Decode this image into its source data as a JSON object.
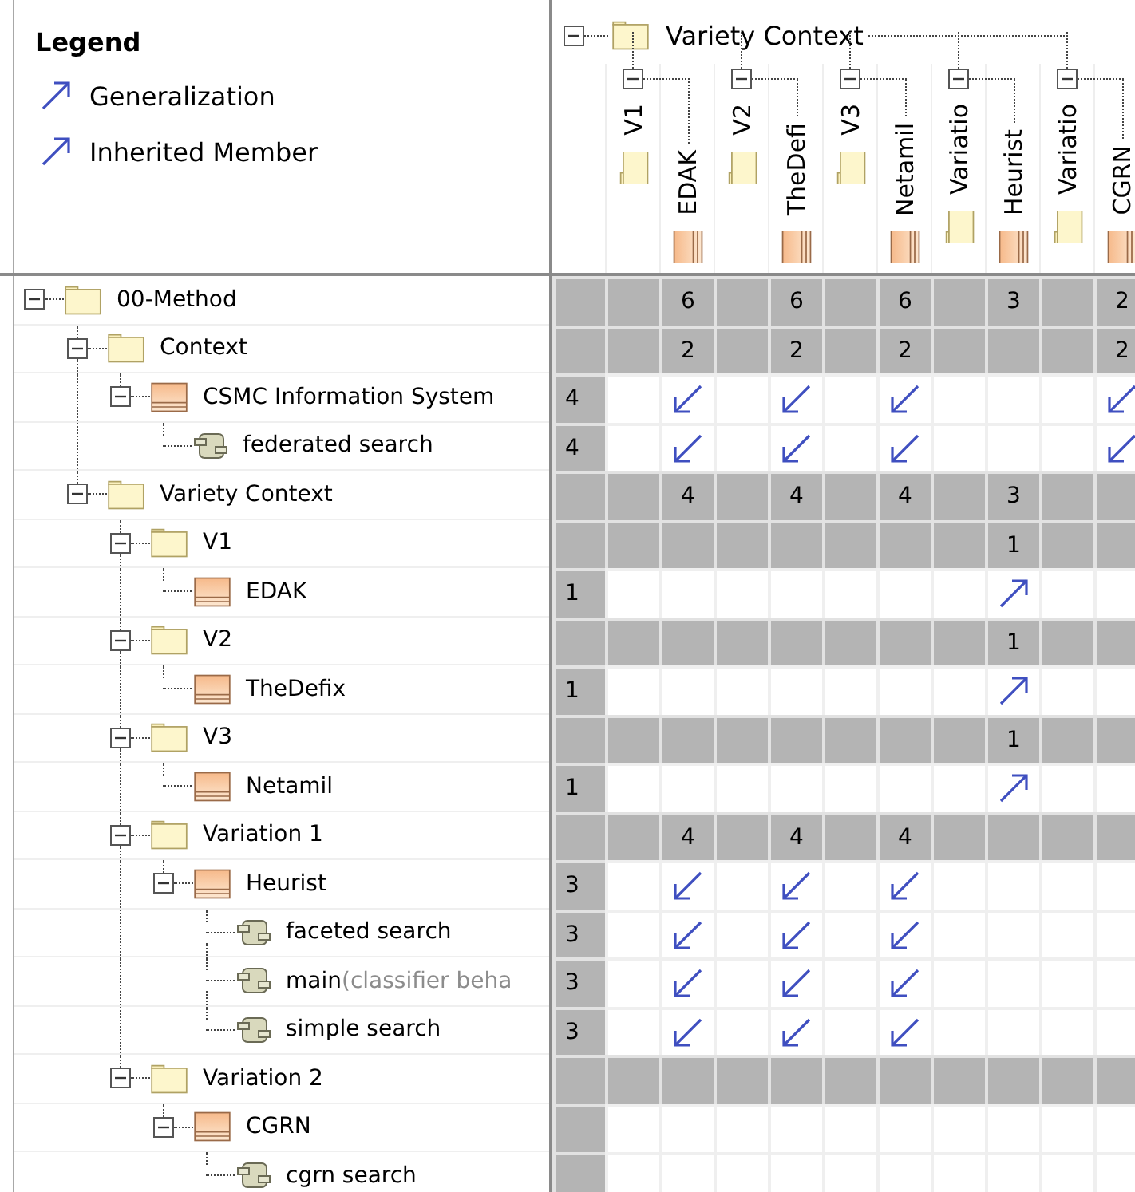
{
  "legend": {
    "title": "Legend",
    "items": [
      {
        "label": "Generalization"
      },
      {
        "label": "Inherited Member"
      }
    ]
  },
  "column_tree": {
    "name": "Variety Context",
    "kind": "package",
    "expanded": true,
    "children": [
      {
        "name": "V1",
        "kind": "package",
        "expanded": true,
        "children": [
          {
            "name": "EDAK",
            "kind": "class"
          }
        ]
      },
      {
        "name": "V2",
        "kind": "package",
        "expanded": true,
        "children": [
          {
            "name": "TheDefi",
            "kind": "class"
          }
        ]
      },
      {
        "name": "V3",
        "kind": "package",
        "expanded": true,
        "children": [
          {
            "name": "Netamil",
            "kind": "class"
          }
        ]
      },
      {
        "name": "Variatio",
        "kind": "package",
        "expanded": true,
        "children": [
          {
            "name": "Heurist",
            "kind": "class"
          }
        ]
      },
      {
        "name": "Variatio",
        "kind": "package",
        "expanded": true,
        "children": [
          {
            "name": "CGRN",
            "kind": "class"
          }
        ]
      }
    ]
  },
  "row_tree": [
    {
      "name": "00-Method",
      "kind": "package",
      "expanded": true,
      "cells": [
        {
          "kind": "empty"
        },
        {
          "kind": "count",
          "text": "6"
        },
        {
          "kind": "empty"
        },
        {
          "kind": "count",
          "text": "6"
        },
        {
          "kind": "empty"
        },
        {
          "kind": "count",
          "text": "6"
        },
        {
          "kind": "empty"
        },
        {
          "kind": "count",
          "text": "3"
        },
        {
          "kind": "empty"
        },
        {
          "kind": "count",
          "text": "2"
        }
      ],
      "children": [
        {
          "name": "Context",
          "kind": "package",
          "expanded": true,
          "cells": [
            {
              "kind": "empty"
            },
            {
              "kind": "count",
              "text": "2"
            },
            {
              "kind": "empty"
            },
            {
              "kind": "count",
              "text": "2"
            },
            {
              "kind": "empty"
            },
            {
              "kind": "count",
              "text": "2"
            },
            {
              "kind": "empty"
            },
            {
              "kind": "empty"
            },
            {
              "kind": "empty"
            },
            {
              "kind": "count",
              "text": "2"
            }
          ],
          "children": [
            {
              "name": "CSMC Information System",
              "kind": "class",
              "expanded": true,
              "total": "4",
              "cells": [
                {
                  "kind": "empty"
                },
                {
                  "kind": "down-left"
                },
                {
                  "kind": "empty"
                },
                {
                  "kind": "down-left"
                },
                {
                  "kind": "empty"
                },
                {
                  "kind": "down-left"
                },
                {
                  "kind": "empty"
                },
                {
                  "kind": "empty"
                },
                {
                  "kind": "empty"
                },
                {
                  "kind": "down-left"
                }
              ],
              "children": [
                {
                  "name": "federated search",
                  "kind": "part",
                  "total": "4",
                  "cells": [
                    {
                      "kind": "empty"
                    },
                    {
                      "kind": "down-left"
                    },
                    {
                      "kind": "empty"
                    },
                    {
                      "kind": "down-left"
                    },
                    {
                      "kind": "empty"
                    },
                    {
                      "kind": "down-left"
                    },
                    {
                      "kind": "empty"
                    },
                    {
                      "kind": "empty"
                    },
                    {
                      "kind": "empty"
                    },
                    {
                      "kind": "down-left"
                    }
                  ]
                }
              ]
            }
          ]
        },
        {
          "name": "Variety Context",
          "kind": "package",
          "expanded": true,
          "cells": [
            {
              "kind": "empty"
            },
            {
              "kind": "count",
              "text": "4"
            },
            {
              "kind": "empty"
            },
            {
              "kind": "count",
              "text": "4"
            },
            {
              "kind": "empty"
            },
            {
              "kind": "count",
              "text": "4"
            },
            {
              "kind": "empty"
            },
            {
              "kind": "count",
              "text": "3"
            },
            {
              "kind": "empty"
            },
            {
              "kind": "empty"
            }
          ],
          "children": [
            {
              "name": "V1",
              "kind": "package",
              "expanded": true,
              "cells": [
                {
                  "kind": "empty"
                },
                {
                  "kind": "empty"
                },
                {
                  "kind": "empty"
                },
                {
                  "kind": "empty"
                },
                {
                  "kind": "empty"
                },
                {
                  "kind": "empty"
                },
                {
                  "kind": "empty"
                },
                {
                  "kind": "count",
                  "text": "1"
                },
                {
                  "kind": "empty"
                },
                {
                  "kind": "empty"
                }
              ],
              "children": [
                {
                  "name": "EDAK",
                  "kind": "class",
                  "total": "1",
                  "cells": [
                    {
                      "kind": "empty"
                    },
                    {
                      "kind": "empty"
                    },
                    {
                      "kind": "empty"
                    },
                    {
                      "kind": "empty"
                    },
                    {
                      "kind": "empty"
                    },
                    {
                      "kind": "empty"
                    },
                    {
                      "kind": "empty"
                    },
                    {
                      "kind": "up-right"
                    },
                    {
                      "kind": "empty"
                    },
                    {
                      "kind": "empty"
                    }
                  ]
                }
              ]
            },
            {
              "name": "V2",
              "kind": "package",
              "expanded": true,
              "cells": [
                {
                  "kind": "empty"
                },
                {
                  "kind": "empty"
                },
                {
                  "kind": "empty"
                },
                {
                  "kind": "empty"
                },
                {
                  "kind": "empty"
                },
                {
                  "kind": "empty"
                },
                {
                  "kind": "empty"
                },
                {
                  "kind": "count",
                  "text": "1"
                },
                {
                  "kind": "empty"
                },
                {
                  "kind": "empty"
                }
              ],
              "children": [
                {
                  "name": "TheDefix",
                  "kind": "class",
                  "total": "1",
                  "cells": [
                    {
                      "kind": "empty"
                    },
                    {
                      "kind": "empty"
                    },
                    {
                      "kind": "empty"
                    },
                    {
                      "kind": "empty"
                    },
                    {
                      "kind": "empty"
                    },
                    {
                      "kind": "empty"
                    },
                    {
                      "kind": "empty"
                    },
                    {
                      "kind": "up-right"
                    },
                    {
                      "kind": "empty"
                    },
                    {
                      "kind": "empty"
                    }
                  ]
                }
              ]
            },
            {
              "name": "V3",
              "kind": "package",
              "expanded": true,
              "cells": [
                {
                  "kind": "empty"
                },
                {
                  "kind": "empty"
                },
                {
                  "kind": "empty"
                },
                {
                  "kind": "empty"
                },
                {
                  "kind": "empty"
                },
                {
                  "kind": "empty"
                },
                {
                  "kind": "empty"
                },
                {
                  "kind": "count",
                  "text": "1"
                },
                {
                  "kind": "empty"
                },
                {
                  "kind": "empty"
                }
              ],
              "children": [
                {
                  "name": "Netamil",
                  "kind": "class",
                  "total": "1",
                  "cells": [
                    {
                      "kind": "empty"
                    },
                    {
                      "kind": "empty"
                    },
                    {
                      "kind": "empty"
                    },
                    {
                      "kind": "empty"
                    },
                    {
                      "kind": "empty"
                    },
                    {
                      "kind": "empty"
                    },
                    {
                      "kind": "empty"
                    },
                    {
                      "kind": "up-right"
                    },
                    {
                      "kind": "empty"
                    },
                    {
                      "kind": "empty"
                    }
                  ]
                }
              ]
            },
            {
              "name": "Variation 1",
              "kind": "package",
              "expanded": true,
              "cells": [
                {
                  "kind": "empty"
                },
                {
                  "kind": "count",
                  "text": "4"
                },
                {
                  "kind": "empty"
                },
                {
                  "kind": "count",
                  "text": "4"
                },
                {
                  "kind": "empty"
                },
                {
                  "kind": "count",
                  "text": "4"
                },
                {
                  "kind": "empty"
                },
                {
                  "kind": "empty"
                },
                {
                  "kind": "empty"
                },
                {
                  "kind": "empty"
                }
              ],
              "children": [
                {
                  "name": "Heurist",
                  "kind": "class",
                  "expanded": true,
                  "total": "3",
                  "cells": [
                    {
                      "kind": "empty"
                    },
                    {
                      "kind": "down-left"
                    },
                    {
                      "kind": "empty"
                    },
                    {
                      "kind": "down-left"
                    },
                    {
                      "kind": "empty"
                    },
                    {
                      "kind": "down-left"
                    },
                    {
                      "kind": "empty"
                    },
                    {
                      "kind": "empty"
                    },
                    {
                      "kind": "empty"
                    },
                    {
                      "kind": "empty"
                    }
                  ],
                  "children": [
                    {
                      "name": "faceted search",
                      "kind": "part",
                      "total": "3",
                      "cells": [
                        {
                          "kind": "empty"
                        },
                        {
                          "kind": "down-left"
                        },
                        {
                          "kind": "empty"
                        },
                        {
                          "kind": "down-left"
                        },
                        {
                          "kind": "empty"
                        },
                        {
                          "kind": "down-left"
                        },
                        {
                          "kind": "empty"
                        },
                        {
                          "kind": "empty"
                        },
                        {
                          "kind": "empty"
                        },
                        {
                          "kind": "empty"
                        }
                      ]
                    },
                    {
                      "name": "main",
                      "detail": "(classifier beha",
                      "kind": "part",
                      "total": "3",
                      "cells": [
                        {
                          "kind": "empty"
                        },
                        {
                          "kind": "down-left"
                        },
                        {
                          "kind": "empty"
                        },
                        {
                          "kind": "down-left"
                        },
                        {
                          "kind": "empty"
                        },
                        {
                          "kind": "down-left"
                        },
                        {
                          "kind": "empty"
                        },
                        {
                          "kind": "empty"
                        },
                        {
                          "kind": "empty"
                        },
                        {
                          "kind": "empty"
                        }
                      ]
                    },
                    {
                      "name": "simple search",
                      "kind": "part",
                      "total": "3",
                      "cells": [
                        {
                          "kind": "empty"
                        },
                        {
                          "kind": "down-left"
                        },
                        {
                          "kind": "empty"
                        },
                        {
                          "kind": "down-left"
                        },
                        {
                          "kind": "empty"
                        },
                        {
                          "kind": "down-left"
                        },
                        {
                          "kind": "empty"
                        },
                        {
                          "kind": "empty"
                        },
                        {
                          "kind": "empty"
                        },
                        {
                          "kind": "empty"
                        }
                      ]
                    }
                  ]
                }
              ]
            },
            {
              "name": "Variation 2",
              "kind": "package",
              "expanded": true,
              "cells": [
                {
                  "kind": "empty"
                },
                {
                  "kind": "empty"
                },
                {
                  "kind": "empty"
                },
                {
                  "kind": "empty"
                },
                {
                  "kind": "empty"
                },
                {
                  "kind": "empty"
                },
                {
                  "kind": "empty"
                },
                {
                  "kind": "empty"
                },
                {
                  "kind": "empty"
                },
                {
                  "kind": "empty"
                }
              ],
              "children": [
                {
                  "name": "CGRN",
                  "kind": "class",
                  "expanded": true,
                  "cells": [
                    {
                      "kind": "empty"
                    },
                    {
                      "kind": "empty"
                    },
                    {
                      "kind": "empty"
                    },
                    {
                      "kind": "empty"
                    },
                    {
                      "kind": "empty"
                    },
                    {
                      "kind": "empty"
                    },
                    {
                      "kind": "empty"
                    },
                    {
                      "kind": "empty"
                    },
                    {
                      "kind": "empty"
                    },
                    {
                      "kind": "empty"
                    }
                  ],
                  "children": [
                    {
                      "name": "cgrn search",
                      "kind": "part",
                      "cells": [
                        {
                          "kind": "empty"
                        },
                        {
                          "kind": "empty"
                        },
                        {
                          "kind": "empty"
                        },
                        {
                          "kind": "empty"
                        },
                        {
                          "kind": "empty"
                        },
                        {
                          "kind": "empty"
                        },
                        {
                          "kind": "empty"
                        },
                        {
                          "kind": "empty"
                        },
                        {
                          "kind": "empty"
                        },
                        {
                          "kind": "empty"
                        }
                      ]
                    }
                  ]
                }
              ]
            }
          ]
        }
      ]
    }
  ]
}
